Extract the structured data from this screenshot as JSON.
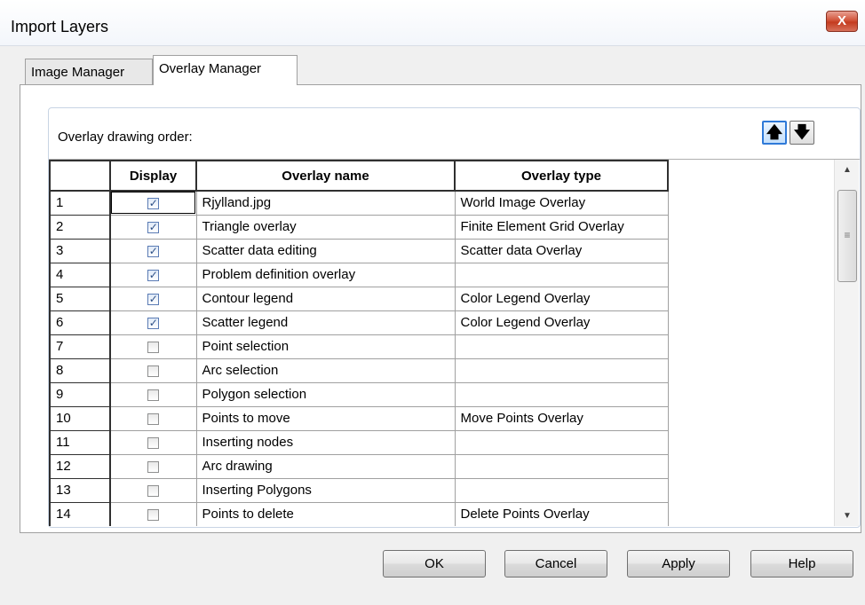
{
  "window": {
    "title": "Import Layers",
    "close_glyph": "X"
  },
  "tabs": [
    {
      "label": "Image Manager",
      "active": false
    },
    {
      "label": "Overlay Manager",
      "active": true
    }
  ],
  "group": {
    "label": "Overlay drawing order:",
    "move_up_icon": "arrow-up-icon",
    "move_down_icon": "arrow-down-icon"
  },
  "grid": {
    "columns": [
      "",
      "Display",
      "Overlay name",
      "Overlay type"
    ],
    "rows": [
      {
        "num": "1",
        "display": true,
        "name": "Rjylland.jpg",
        "type": "World Image Overlay"
      },
      {
        "num": "2",
        "display": true,
        "name": "Triangle overlay",
        "type": "Finite Element Grid Overlay"
      },
      {
        "num": "3",
        "display": true,
        "name": "Scatter data editing",
        "type": "Scatter data Overlay"
      },
      {
        "num": "4",
        "display": true,
        "name": "Problem definition overlay",
        "type": ""
      },
      {
        "num": "5",
        "display": true,
        "name": "Contour legend",
        "type": "Color Legend Overlay"
      },
      {
        "num": "6",
        "display": true,
        "name": "Scatter legend",
        "type": "Color Legend Overlay"
      },
      {
        "num": "7",
        "display": false,
        "name": "Point selection",
        "type": ""
      },
      {
        "num": "8",
        "display": false,
        "name": "Arc selection",
        "type": ""
      },
      {
        "num": "9",
        "display": false,
        "name": "Polygon selection",
        "type": ""
      },
      {
        "num": "10",
        "display": false,
        "name": "Points to move",
        "type": "Move Points Overlay"
      },
      {
        "num": "11",
        "display": false,
        "name": "Inserting nodes",
        "type": ""
      },
      {
        "num": "12",
        "display": false,
        "name": "Arc drawing",
        "type": ""
      },
      {
        "num": "13",
        "display": false,
        "name": "Inserting Polygons",
        "type": ""
      },
      {
        "num": "14",
        "display": false,
        "name": "Points to delete",
        "type": "Delete Points Overlay"
      }
    ]
  },
  "buttons": {
    "ok": "OK",
    "cancel": "Cancel",
    "apply": "Apply",
    "help": "Help"
  },
  "colors": {
    "close_red": "#c43b1f",
    "accent_blue": "#2f7ad8",
    "check_blue": "#2c4f86"
  }
}
